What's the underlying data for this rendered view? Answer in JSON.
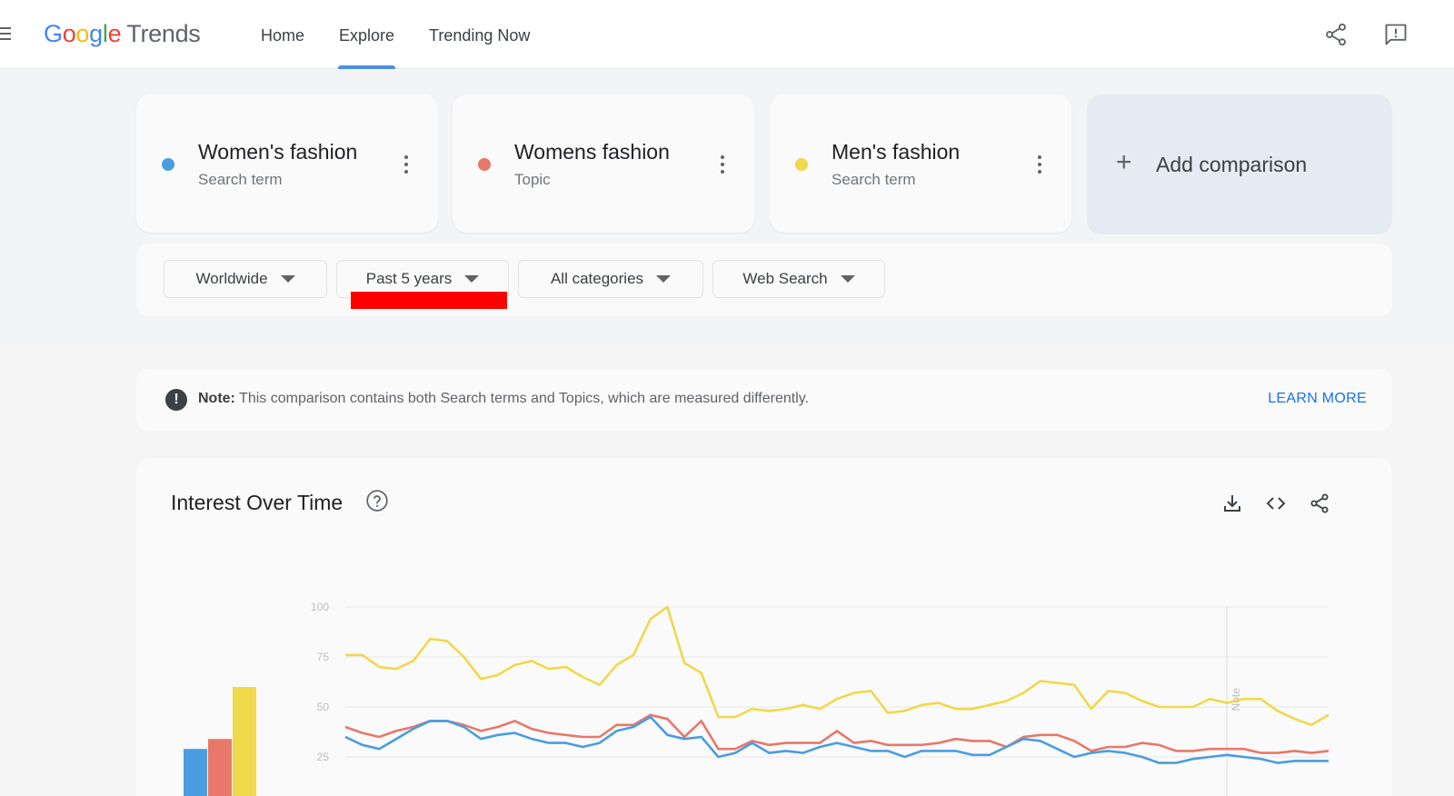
{
  "header": {
    "logo_brand": "Google",
    "logo_product": "Trends",
    "tabs": [
      {
        "label": "Home"
      },
      {
        "label": "Explore"
      },
      {
        "label": "Trending Now"
      }
    ],
    "active_tab": "Explore"
  },
  "terms": [
    {
      "name": "Women's fashion",
      "type": "Search term",
      "color": "#4a9de0"
    },
    {
      "name": "Womens fashion",
      "type": "Topic",
      "color": "#e8786a"
    },
    {
      "name": "Men's fashion",
      "type": "Search term",
      "color": "#f0d84b"
    }
  ],
  "add_comparison": {
    "label": "Add comparison"
  },
  "filters": {
    "region": "Worldwide",
    "time": "Past 5 years",
    "category": "All categories",
    "search_type": "Web Search"
  },
  "note": {
    "label": "Note:",
    "text": "This comparison contains both Search terms and Topics, which are measured differently.",
    "link": "LEARN MORE"
  },
  "interest": {
    "title": "Interest Over Time",
    "marker_label": "Note"
  },
  "chart_data": {
    "type": "line",
    "ylim": [
      0,
      100
    ],
    "yticks": [
      25,
      50,
      75,
      100
    ],
    "marker_index": 52,
    "series": [
      {
        "name": "Men's fashion",
        "color": "#f0d84b",
        "values": [
          76,
          76,
          70,
          69,
          73,
          84,
          83,
          75,
          64,
          66,
          71,
          73,
          69,
          70,
          65,
          61,
          71,
          76,
          94,
          100,
          72,
          67,
          45,
          45,
          49,
          48,
          49,
          51,
          49,
          54,
          57,
          58,
          47,
          48,
          51,
          52,
          49,
          49,
          51,
          53,
          57,
          63,
          62,
          61,
          49,
          58,
          57,
          53,
          50,
          50,
          50,
          54,
          52,
          54,
          54,
          48,
          44,
          41,
          46
        ]
      },
      {
        "name": "Womens fashion",
        "color": "#e8786a",
        "values": [
          40,
          37,
          35,
          38,
          40,
          43,
          43,
          41,
          38,
          40,
          43,
          39,
          37,
          36,
          35,
          35,
          41,
          41,
          46,
          44,
          35,
          43,
          29,
          29,
          33,
          31,
          32,
          32,
          32,
          38,
          32,
          33,
          31,
          31,
          31,
          32,
          34,
          33,
          33,
          30,
          35,
          36,
          36,
          33,
          28,
          30,
          30,
          32,
          31,
          28,
          28,
          29,
          29,
          29,
          27,
          27,
          28,
          27,
          28
        ]
      },
      {
        "name": "Women's fashion",
        "color": "#4a9de0",
        "values": [
          35,
          31,
          29,
          34,
          39,
          43,
          43,
          40,
          34,
          36,
          37,
          34,
          32,
          32,
          30,
          32,
          38,
          40,
          45,
          36,
          34,
          35,
          25,
          27,
          32,
          27,
          28,
          27,
          30,
          32,
          30,
          28,
          28,
          25,
          28,
          28,
          28,
          26,
          26,
          30,
          34,
          33,
          29,
          25,
          27,
          28,
          27,
          25,
          22,
          22,
          24,
          25,
          26,
          25,
          24,
          22,
          23,
          23,
          23
        ]
      }
    ],
    "bar_summary": [
      {
        "name": "Women's fashion",
        "color": "#4a9de0",
        "value": 29
      },
      {
        "name": "Womens fashion",
        "color": "#e8786a",
        "value": 34
      },
      {
        "name": "Men's fashion",
        "color": "#f0d84b",
        "value": 60
      }
    ]
  }
}
